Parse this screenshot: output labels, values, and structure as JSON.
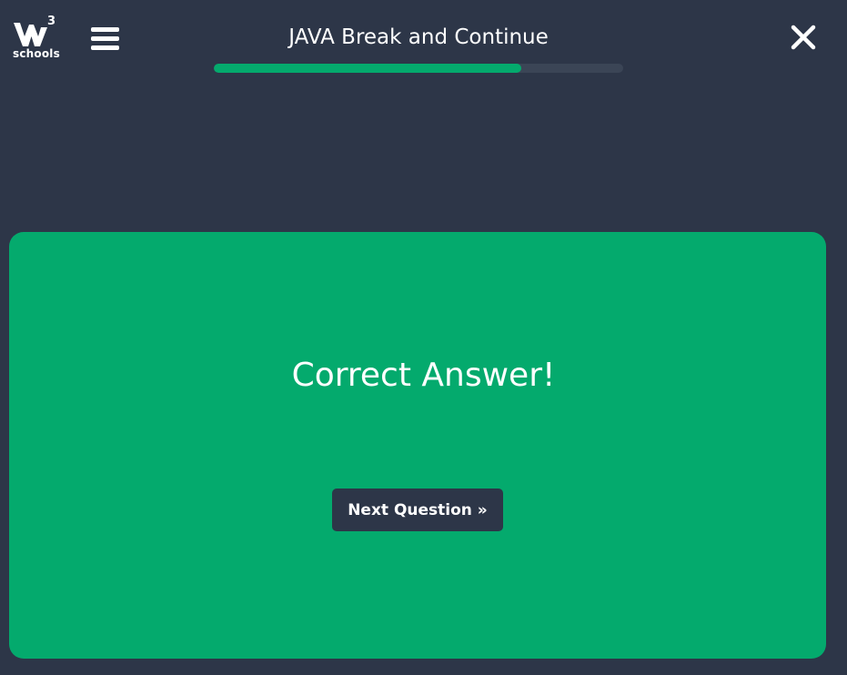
{
  "header": {
    "logo_superscript": "3",
    "logo_wordmark": "schools",
    "title": "JAVA Break and Continue",
    "progress_fraction": 0.75
  },
  "result": {
    "heading": "Correct Answer!",
    "next_label": "Next Question »"
  },
  "icons": {
    "logo": "w3schools-logo-icon",
    "menu": "hamburger-menu-icon",
    "close": "close-icon"
  },
  "colors": {
    "background": "#2d3648",
    "accent": "#04aa6d",
    "progress_track": "#3b4556",
    "text": "#ffffff"
  }
}
